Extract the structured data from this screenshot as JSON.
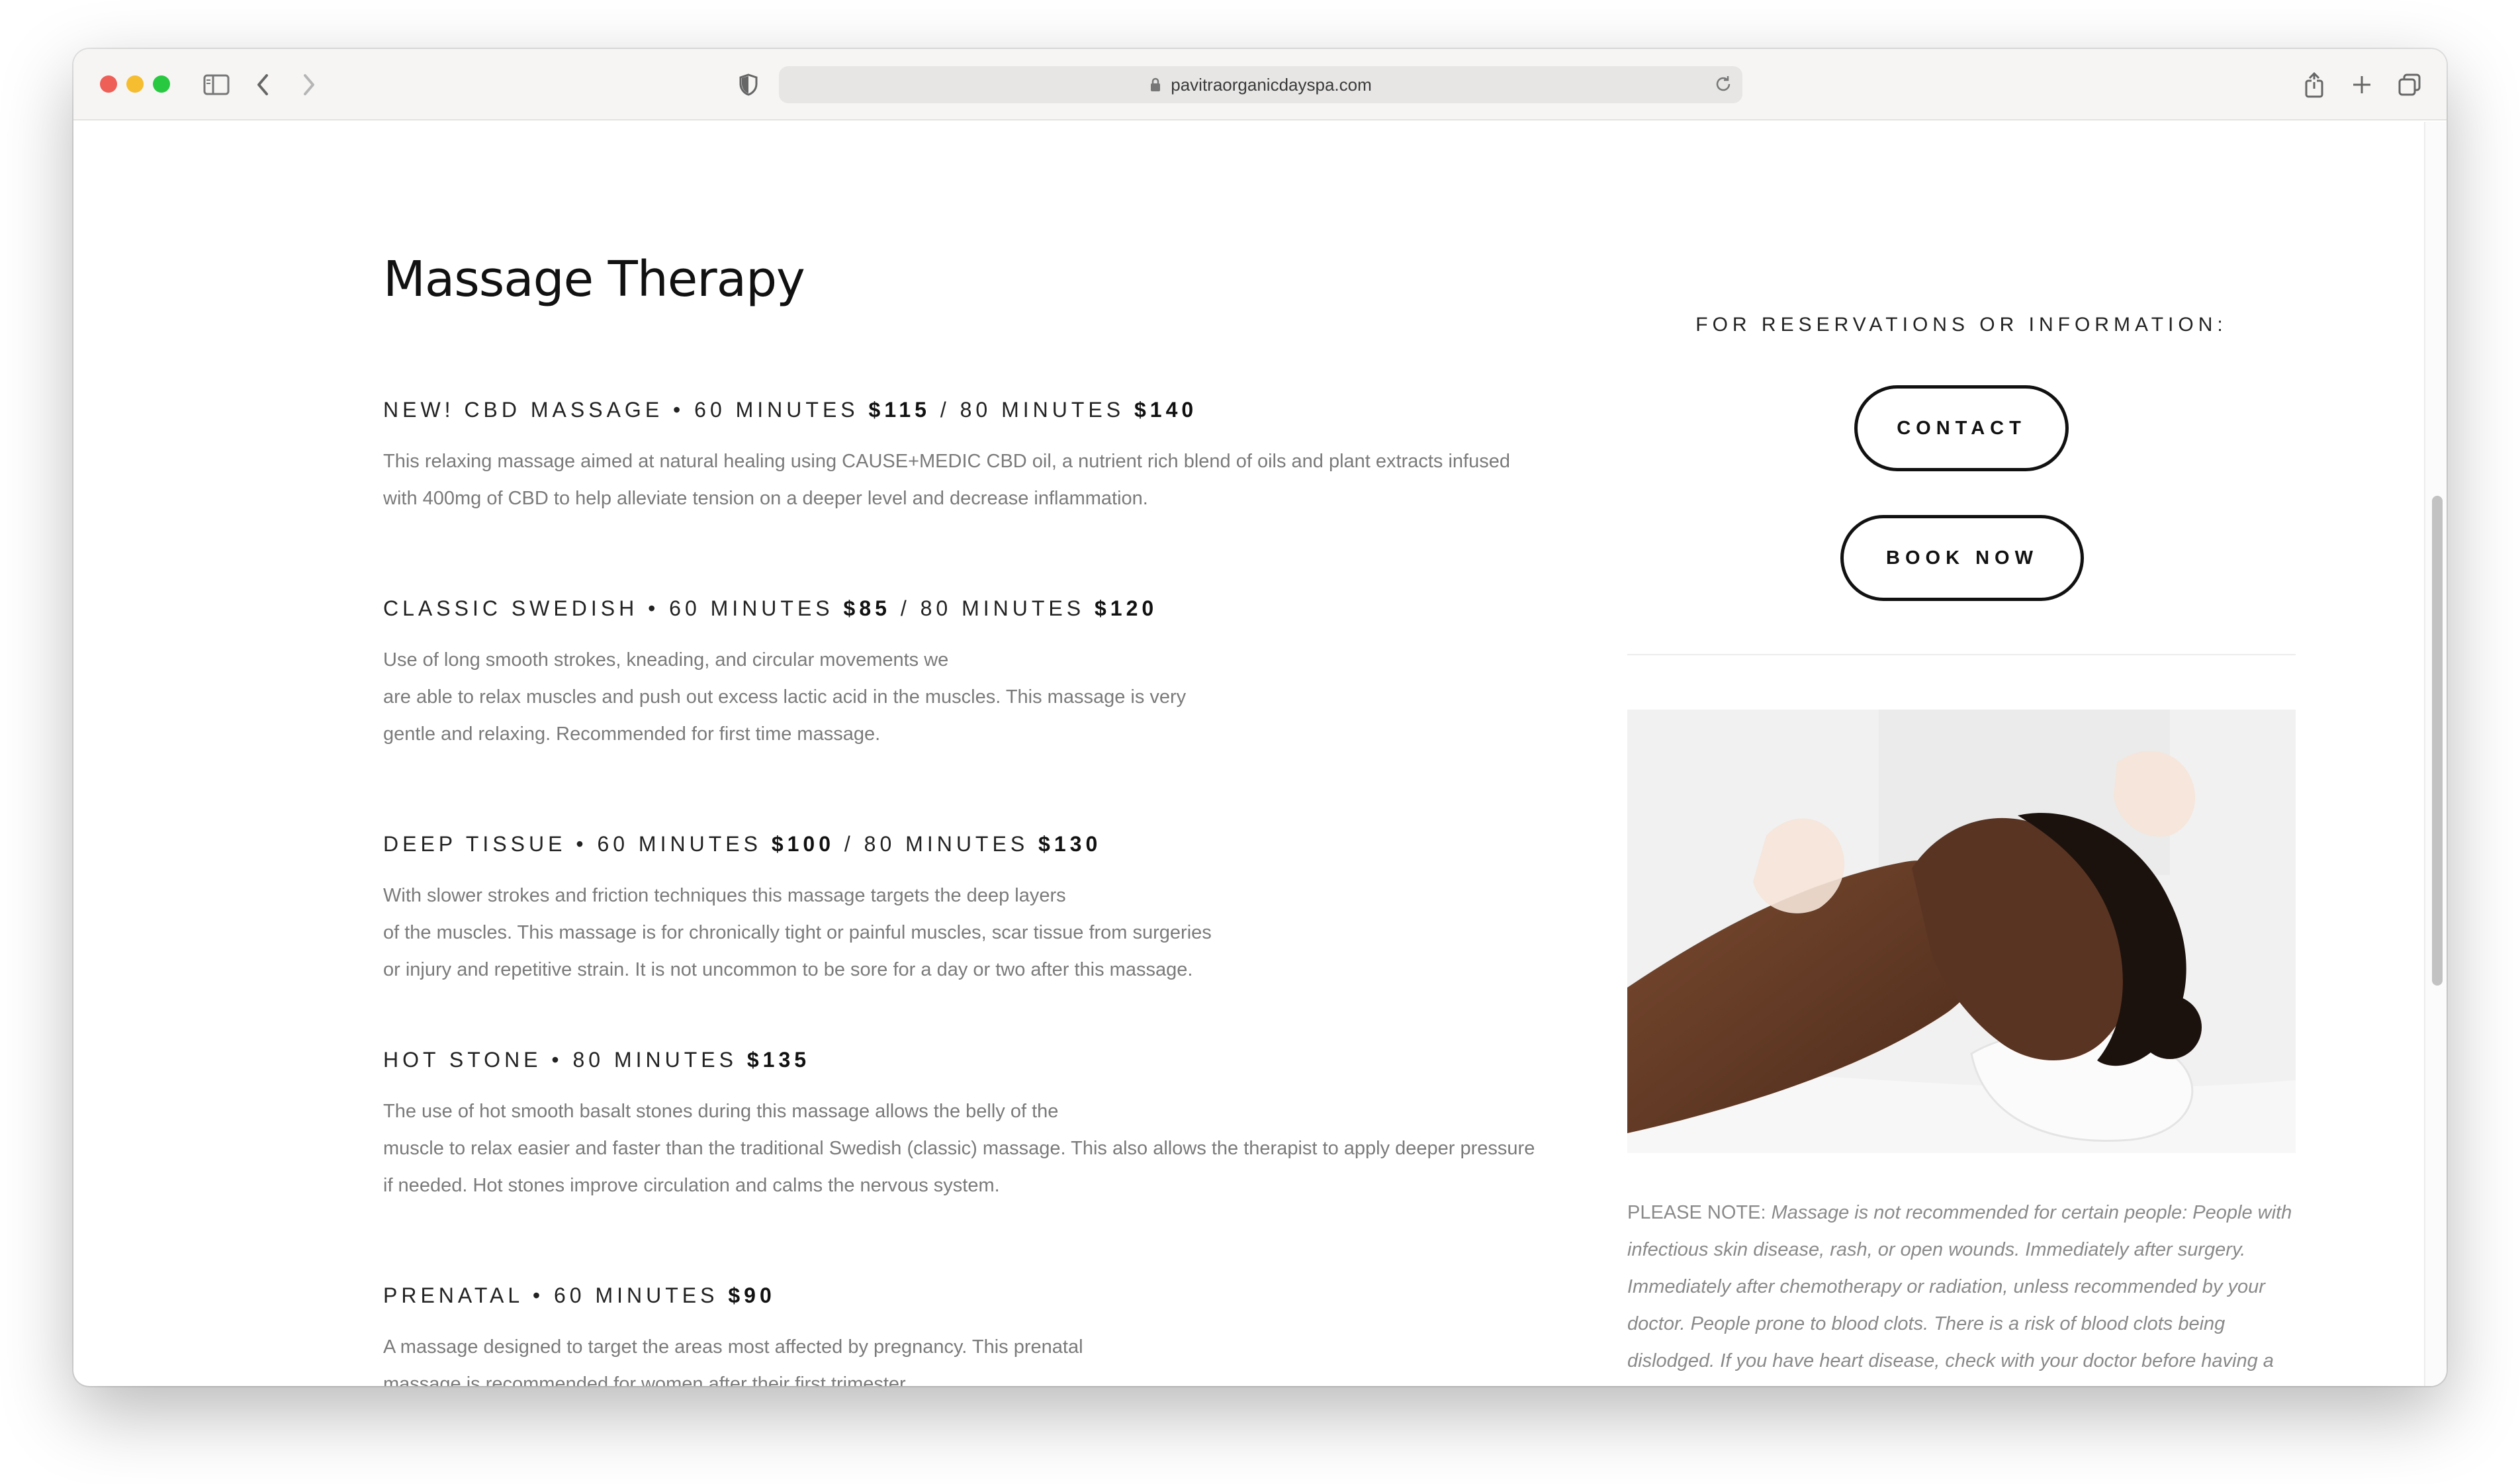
{
  "browser": {
    "url": "pavitraorganicdayspa.com"
  },
  "page": {
    "title": "Massage Therapy",
    "services": [
      {
        "name": "NEW! CBD MASSAGE",
        "dur1": "60 MINUTES",
        "price1": "$115",
        "dur2": "80 MINUTES",
        "price2": "$140",
        "lines": [
          "This relaxing massage aimed at natural healing using CAUSE+MEDIC CBD oil, a nutrient rich blend of oils and plant extracts infused",
          "with 400mg of CBD to help alleviate tension on a deeper level and decrease inflammation."
        ]
      },
      {
        "name": "CLASSIC SWEDISH",
        "dur1": "60 MINUTES",
        "price1": "$85",
        "dur2": "80 MINUTES",
        "price2": "$120",
        "lines": [
          "Use of long smooth strokes, kneading, and circular movements we",
          "are able to relax muscles and push out excess lactic acid in the muscles. This massage is very",
          "gentle and relaxing. Recommended for first time massage."
        ]
      },
      {
        "name": "DEEP TISSUE",
        "dur1": "60 MINUTES",
        "price1": "$100",
        "dur2": "80 MINUTES",
        "price2": "$130",
        "lines": [
          "With slower strokes and friction techniques this massage targets the deep layers",
          "of the muscles. This massage is for chronically tight or painful muscles, scar tissue from surgeries",
          "or injury and repetitive strain. It is not uncommon to be sore for a day or two after this massage."
        ]
      },
      {
        "name": "HOT STONE",
        "dur1": "80 MINUTES",
        "price1": "$135",
        "lines": [
          "The use of hot smooth basalt stones during this massage allows the belly of the",
          "muscle to relax easier and faster than the traditional Swedish (classic) massage. This also allows the therapist to apply deeper pressure",
          "if needed. Hot stones improve circulation and calms the nervous system."
        ]
      },
      {
        "name": "PRENATAL",
        "dur1": "60 MINUTES",
        "price1": "$90",
        "lines": [
          "A massage designed to target the areas most affected by pregnancy. This prenatal",
          "massage is recommended for women after their first trimester."
        ]
      }
    ],
    "sidebar": {
      "label": "FOR RESERVATIONS OR INFORMATION:",
      "contact": "CONTACT",
      "book": "BOOK NOW",
      "note_prefix": "PLEASE NOTE: ",
      "note_body": "Massage is not recommended for certain people: People with infectious skin disease, rash, or open wounds. Immediately after surgery. Immediately after chemotherapy or radiation, unless recommended by your doctor. People prone to blood clots. There is a risk of blood clots being dislodged. If you have heart disease, check with your doctor before having a massage. Pregnant women in their first trimester. Pregnant women should check with their doctor first if they are considering massage."
    }
  },
  "colors": {
    "text_dark": "#111111",
    "text_muted": "#7a7a7a",
    "toolbar_bg": "#f6f5f4"
  }
}
